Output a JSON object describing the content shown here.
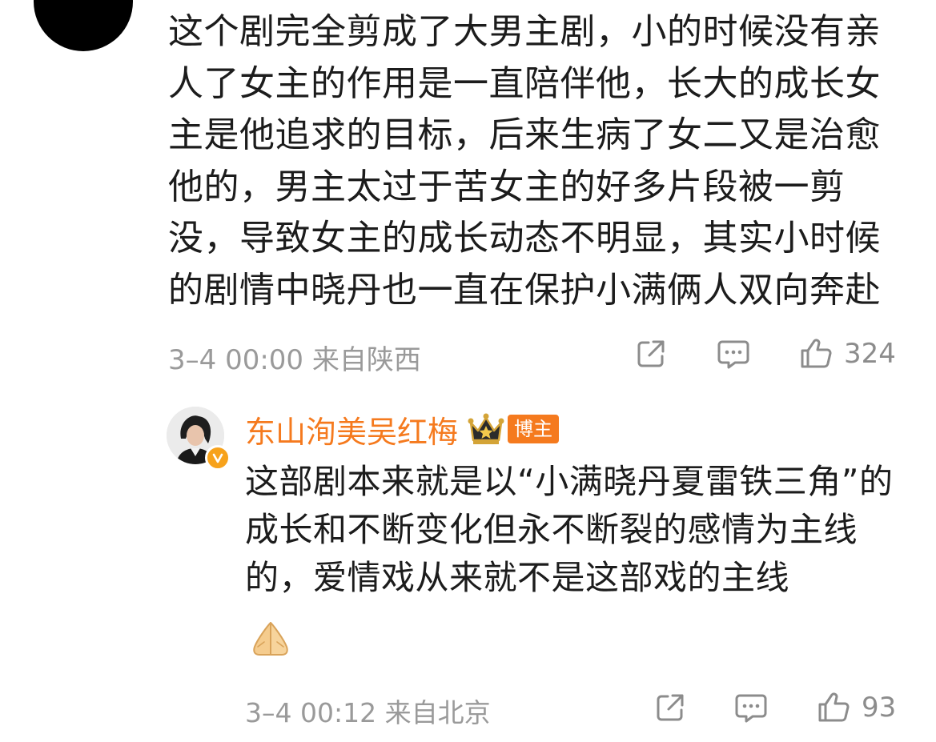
{
  "comment": {
    "text": "这个剧完全剪成了大男主剧，小的时候没有亲人了女主的作用是一直陪伴他，长大的成长女主是他追求的目标，后来生病了女二又是治愈他的，男主太过于苦女主的好多片段被一剪没，导致女主的成长动态不明显，其实小时候的剧情中晓丹也一直在保护小满俩人双向奔赴",
    "time_location": "3–4 00:00  来自陕西",
    "like_count": "324",
    "icons": [
      "share-icon",
      "comment-icon",
      "like-icon"
    ]
  },
  "reply": {
    "author": "东山洵美吴红梅",
    "badge": "博主",
    "text": "这部剧本来就是以“小满晓丹夏雷铁三角”的成长和不断变化但永不断裂的感情为主线的，爱情戏从来就不是这部戏的主线",
    "emoji": "folded-hands-emoji",
    "time_location": "3–4 00:12  来自北京",
    "like_count": "93",
    "icons": [
      "share-icon",
      "comment-icon",
      "like-icon"
    ]
  },
  "colors": {
    "author_name": "#f57a1e",
    "meta_text": "#9a9a9a",
    "badge_bg": "#f57a1e",
    "verified_badge": "#f7a21b"
  }
}
